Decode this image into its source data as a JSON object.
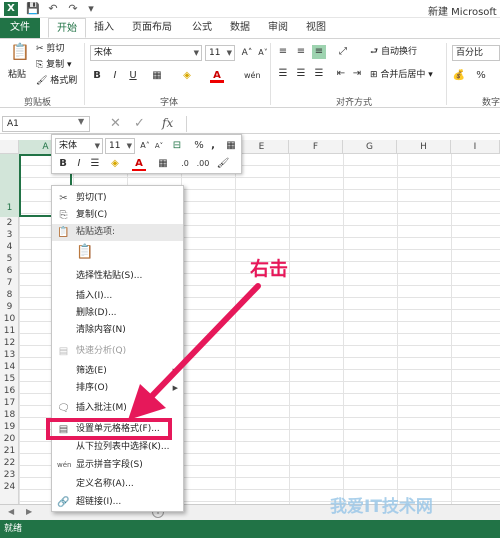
{
  "title_bar": {
    "app_icon": "X",
    "window_title": "新建 Microsoft E"
  },
  "tabs": [
    "文件",
    "开始",
    "插入",
    "页面布局",
    "公式",
    "数据",
    "审阅",
    "视图"
  ],
  "ribbon": {
    "clipboard": {
      "paste": "粘贴",
      "cut": "剪切",
      "copy": "复制",
      "format_painter": "格式刷",
      "label": "剪贴板"
    },
    "font": {
      "name": "宋体",
      "size": "11",
      "bold": "B",
      "italic": "I",
      "underline": "U",
      "label": "字体"
    },
    "alignment": {
      "wrap": "自动换行",
      "merge": "合并后居中",
      "label": "对齐方式"
    },
    "number": {
      "format": "百分比",
      "label": "数字"
    }
  },
  "formula_bar": {
    "name_box": "A1",
    "fx": "fx"
  },
  "columns": [
    "A",
    "B",
    "C",
    "D",
    "E",
    "F",
    "G",
    "H",
    "I"
  ],
  "rows": [
    "1",
    "2",
    "3",
    "4",
    "5",
    "6",
    "7",
    "8",
    "9",
    "10",
    "11",
    "12",
    "13",
    "14",
    "15",
    "16",
    "17",
    "18",
    "19",
    "20",
    "21",
    "22",
    "23",
    "24"
  ],
  "mini_toolbar": {
    "font": "宋体",
    "size": "11",
    "percent": "%",
    "comma": ",",
    "bold": "B",
    "italic": "I"
  },
  "context_menu": [
    {
      "label": "剪切(T)",
      "icon": "scissors-icon"
    },
    {
      "label": "复制(C)",
      "icon": "copy-icon"
    },
    {
      "label": "粘贴选项:",
      "icon": "paste-icon"
    },
    {
      "label": "",
      "icon": "paste-option-icon"
    },
    {
      "label": "选择性粘贴(S)..."
    },
    {
      "label": "插入(I)..."
    },
    {
      "label": "删除(D)..."
    },
    {
      "label": "清除内容(N)"
    },
    {
      "label": "快速分析(Q)",
      "icon": "quick-analysis-icon"
    },
    {
      "label": "筛选(E)"
    },
    {
      "label": "排序(O)"
    },
    {
      "label": "插入批注(M)",
      "icon": "comment-icon"
    },
    {
      "label": "设置单元格格式(F)...",
      "icon": "format-cells-icon"
    },
    {
      "label": "从下拉列表中选择(K)..."
    },
    {
      "label": "显示拼音字段(S)",
      "icon": "phonetic-icon"
    },
    {
      "label": "定义名称(A)..."
    },
    {
      "label": "超链接(I)...",
      "icon": "hyperlink-icon"
    }
  ],
  "annotation": "右击",
  "watermark": "我爱IT技术网",
  "status": "就绪",
  "accent": "#217346",
  "highlight_color": "#e6185a"
}
